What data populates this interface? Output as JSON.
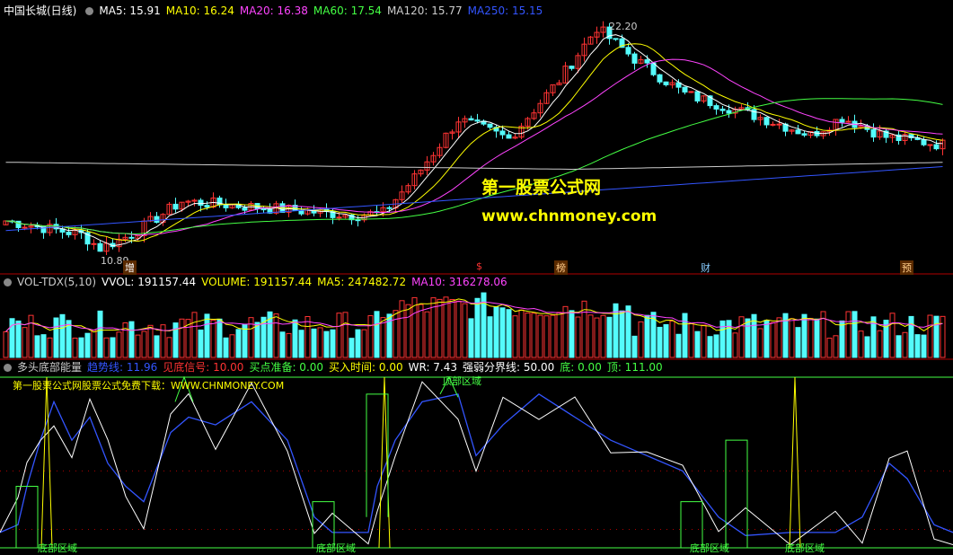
{
  "price_panel": {
    "title": "中国长城(日线)",
    "ma": [
      {
        "label": "MA5: 15.91",
        "color": "#ffffff"
      },
      {
        "label": "MA10: 16.24",
        "color": "#ffff00"
      },
      {
        "label": "MA20: 16.38",
        "color": "#ff44ff"
      },
      {
        "label": "MA60: 17.54",
        "color": "#44ff44"
      },
      {
        "label": "MA120: 15.77",
        "color": "#cccccc"
      },
      {
        "label": "MA250: 15.15",
        "color": "#3355ff"
      }
    ],
    "high_label": "22.20",
    "low_label": "10.89",
    "events": [
      {
        "label": "增",
        "color": "#ffffff"
      },
      {
        "label": "$",
        "color": "#ff3333"
      },
      {
        "label": "榜",
        "color": "#ffcc88"
      },
      {
        "label": "财",
        "color": "#88ccff"
      },
      {
        "label": "预",
        "color": "#ffcc88"
      }
    ]
  },
  "watermark": {
    "name": "第一股票公式网",
    "url": "www.chnmoney.com"
  },
  "volume_panel": {
    "title": "VOL-TDX(5,10)",
    "fields": [
      {
        "label": "VVOL: 191157.44",
        "color": "#ffffff"
      },
      {
        "label": "VOLUME: 191157.44",
        "color": "#ffff00"
      },
      {
        "label": "MA5: 247482.72",
        "color": "#ffff00"
      },
      {
        "label": "MA10: 316278.06",
        "color": "#ff44ff"
      }
    ]
  },
  "indicator_panel": {
    "title": "多头底部能量",
    "fields": [
      {
        "label": "趋势线: 11.96",
        "color": "#3355ff"
      },
      {
        "label": "见底信号: 10.00",
        "color": "#ff3333"
      },
      {
        "label": "买点准备: 0.00",
        "color": "#44ff44"
      },
      {
        "label": "买入时间: 0.00",
        "color": "#ffff00"
      },
      {
        "label": "WR: 7.43",
        "color": "#ffffff"
      },
      {
        "label": "强弱分界线: 50.00",
        "color": "#ffffff"
      },
      {
        "label": "底: 0.00",
        "color": "#44ff44"
      },
      {
        "label": "顶: 111.00",
        "color": "#44ff44"
      }
    ],
    "free_download": "第一股票公式网股票公式免费下载：WWW.CHNMONEY.COM",
    "bottom_zone_labels": [
      "底部区域",
      "底部区域",
      "底部区域",
      "底部区域"
    ],
    "top_zone_label": "顶部区域"
  },
  "colors": {
    "up": "#ff3333",
    "down": "#54fcfc",
    "panel_border": "#b00000",
    "green": "#44ff44",
    "yellow": "#ffff00",
    "blue": "#3355ff",
    "magenta": "#ff44ff"
  }
}
